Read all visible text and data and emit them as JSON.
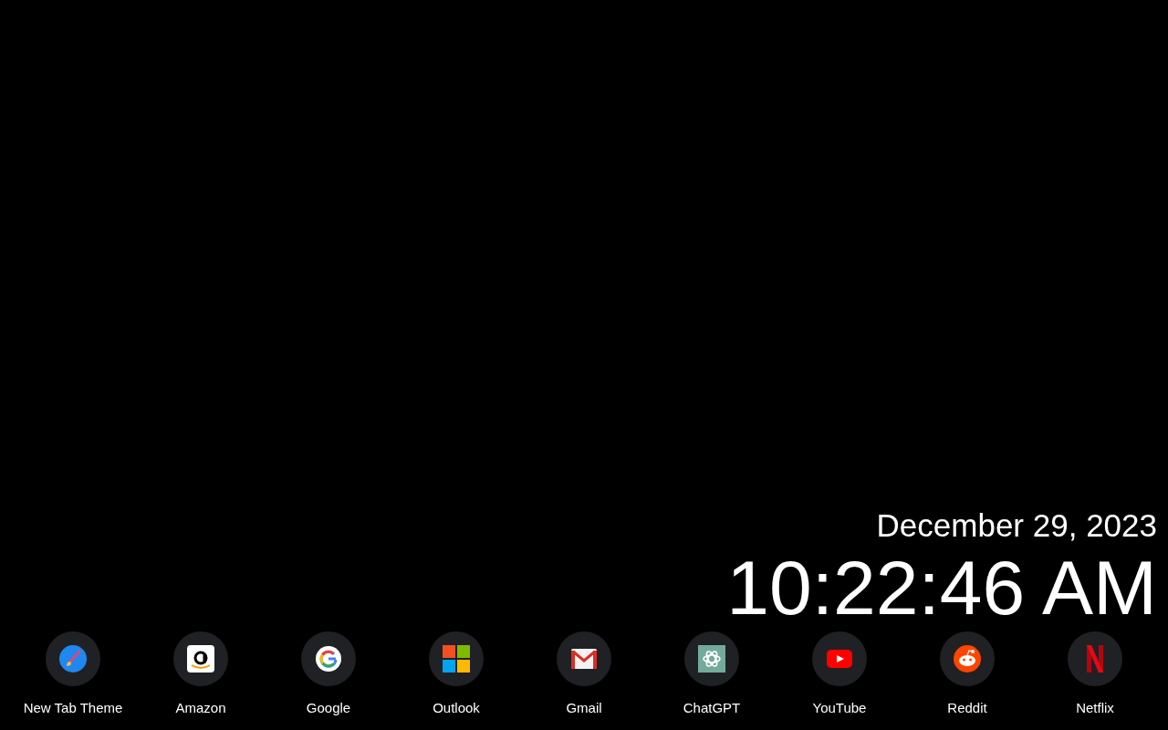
{
  "clock": {
    "date": "December 29, 2023",
    "time": "10:22:46 AM"
  },
  "shortcuts": [
    {
      "label": "New Tab Theme",
      "kind": "brush"
    },
    {
      "label": "Amazon",
      "kind": "amazon"
    },
    {
      "label": "Google",
      "kind": "google"
    },
    {
      "label": "Outlook",
      "kind": "windows"
    },
    {
      "label": "Gmail",
      "kind": "mail"
    },
    {
      "label": "ChatGPT",
      "kind": "knot"
    },
    {
      "label": "YouTube",
      "kind": "play"
    },
    {
      "label": "Reddit",
      "kind": "alien"
    },
    {
      "label": "Netflix",
      "kind": "netflix"
    }
  ]
}
